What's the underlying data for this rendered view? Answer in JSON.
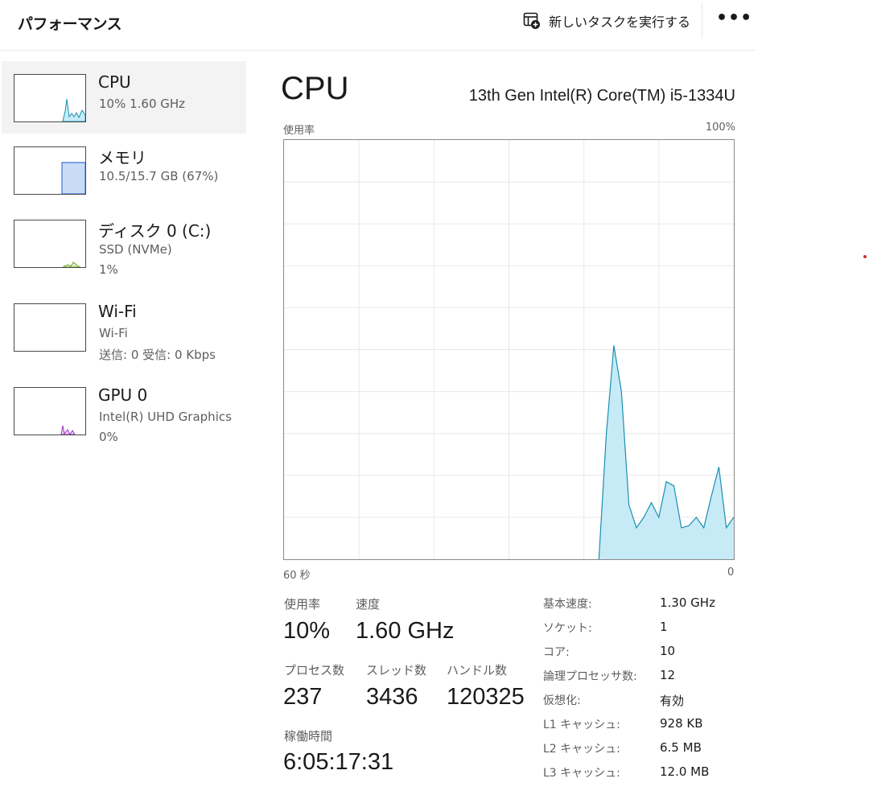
{
  "header": {
    "title": "パフォーマンス",
    "run_task": "新しいタスクを実行する",
    "more": "•••"
  },
  "sidebar": {
    "items": [
      {
        "title": "CPU",
        "line1": "10%  1.60 GHz",
        "line2": "",
        "selected": true,
        "color": "#1b8fb0"
      },
      {
        "title": "メモリ",
        "line1": "10.5/15.7 GB (67%)",
        "line2": "",
        "color": "#3c74d4"
      },
      {
        "title": "ディスク 0 (C:)",
        "line1": "SSD (NVMe)",
        "line2": "1%",
        "color": "#6aa826"
      },
      {
        "title": "Wi-Fi",
        "line1": "Wi-Fi",
        "line2": "送信: 0  受信: 0 Kbps",
        "color": "#a0522d"
      },
      {
        "title": "GPU 0",
        "line1": "Intel(R) UHD Graphics",
        "line2": "0%",
        "color": "#9b2fc7"
      }
    ]
  },
  "main": {
    "title": "CPU",
    "model": "13th Gen Intel(R) Core(TM) i5-1334U",
    "graph_label_left": "使用率",
    "graph_label_right": "100%",
    "axis_left": "60 秒",
    "axis_right": "0"
  },
  "stats": {
    "usage_label": "使用率",
    "usage_value": "10%",
    "speed_label": "速度",
    "speed_value": "1.60 GHz",
    "process_label": "プロセス数",
    "process_value": "237",
    "thread_label": "スレッド数",
    "thread_value": "3436",
    "handle_label": "ハンドル数",
    "handle_value": "120325",
    "uptime_label": "稼働時間",
    "uptime_value": "6:05:17:31"
  },
  "specs": [
    {
      "label": "基本速度:",
      "value": "1.30 GHz"
    },
    {
      "label": "ソケット:",
      "value": "1"
    },
    {
      "label": "コア:",
      "value": "10"
    },
    {
      "label": "論理プロセッサ数:",
      "value": "12"
    },
    {
      "label": "仮想化:",
      "value": "有効"
    },
    {
      "label": "L1 キャッシュ:",
      "value": "928 KB"
    },
    {
      "label": "L2 キャッシュ:",
      "value": "6.5 MB"
    },
    {
      "label": "L3 キャッシュ:",
      "value": "12.0 MB"
    }
  ],
  "chart_data": {
    "type": "area",
    "xlabel": "60 秒",
    "ylabel": "使用率",
    "ylim": [
      0,
      100
    ],
    "xlim": [
      60,
      0
    ],
    "grid": true,
    "colors": {
      "fill": "#c6ebf7",
      "stroke": "#1b8fb0",
      "grid": "#e8e8e8"
    },
    "series": [
      {
        "x": [
          60,
          59,
          58,
          57,
          56,
          55,
          54,
          53,
          52,
          51,
          50,
          49,
          48,
          47,
          46,
          45,
          44,
          43,
          42,
          41,
          40,
          39,
          38,
          37,
          36,
          35,
          34,
          33,
          32,
          31,
          30,
          29,
          28,
          27,
          26,
          25,
          24,
          23,
          22,
          21,
          20,
          19,
          18,
          17,
          16,
          15,
          14,
          13,
          12,
          11,
          10,
          9,
          8,
          7,
          6,
          5,
          4,
          3,
          2,
          1,
          0
        ],
        "values": [
          0,
          0,
          0,
          0,
          0,
          0,
          0,
          0,
          0,
          0,
          0,
          0,
          0,
          0,
          0,
          0,
          0,
          0,
          0,
          0,
          0,
          0,
          0,
          0,
          0,
          0,
          0,
          0,
          0,
          0,
          0,
          0,
          0,
          0,
          0,
          0,
          0,
          0,
          0,
          0,
          0,
          0,
          0,
          30,
          51,
          40,
          13,
          7.5,
          10,
          13.5,
          10,
          18.5,
          17.5,
          7.5,
          8,
          10,
          7.5,
          15,
          22,
          7.5,
          10
        ]
      }
    ]
  }
}
